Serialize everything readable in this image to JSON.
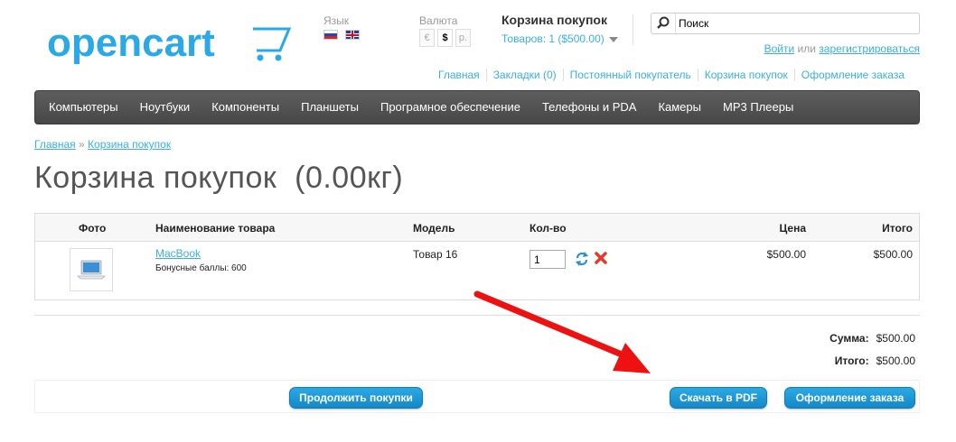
{
  "logo_text": "opencart",
  "language": {
    "label": "Язык",
    "flags": [
      "ru-flag",
      "en-flag"
    ]
  },
  "currency": {
    "label": "Валюта",
    "options": [
      "€",
      "$",
      "р."
    ],
    "selected": "$"
  },
  "cart_summary": {
    "title": "Корзина покупок",
    "total": "Товаров: 1 ($500.00)"
  },
  "search": {
    "placeholder": "Поиск"
  },
  "welcome": {
    "login": "Войти",
    "or": "или",
    "register": "зарегистрироваться"
  },
  "top_links": [
    "Главная",
    "Закладки (0)",
    "Постоянный покупатель",
    "Корзина покупок",
    "Оформление заказа"
  ],
  "menu": [
    "Компьютеры",
    "Ноутбуки",
    "Компоненты",
    "Планшеты",
    "Програмное обеспечение",
    "Телефоны и PDA",
    "Камеры",
    "MP3 Плееры"
  ],
  "breadcrumb": {
    "home": "Главная",
    "sep": "»",
    "current": "Корзина покупок"
  },
  "page_title": "Корзина покупок  (0.00кг)",
  "table": {
    "headers": {
      "image": "Фото",
      "name": "Наименование товара",
      "model": "Модель",
      "quantity": "Кол-во",
      "price": "Цена",
      "total": "Итого"
    },
    "rows": [
      {
        "name": "MacBook",
        "bonus": "Бонусные баллы: 600",
        "model": "Товар 16",
        "quantity": "1",
        "price": "$500.00",
        "total": "$500.00"
      }
    ]
  },
  "totals": [
    {
      "label": "Сумма:",
      "value": "$500.00"
    },
    {
      "label": "Итого:",
      "value": "$500.00"
    }
  ],
  "buttons": {
    "continue": "Продолжить покупки",
    "pdf": "Скачать в PDF",
    "checkout": "Оформление заказа"
  },
  "colors": {
    "accent": "#38b0e3",
    "menu_bg": "#4f4f4f",
    "button": "#1a95d4",
    "arrow": "#ee1111"
  }
}
